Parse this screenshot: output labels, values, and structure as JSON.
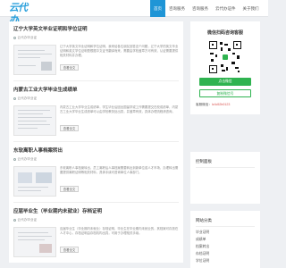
{
  "header": {
    "logo_text": "云代办",
    "nav": [
      {
        "label": "首页",
        "active": true
      },
      {
        "label": "咨询服务",
        "active": false
      },
      {
        "label": "咨询服务",
        "active": false
      },
      {
        "label": "云代办证件",
        "active": false
      },
      {
        "label": "关于我们",
        "active": false
      }
    ]
  },
  "posts": [
    {
      "title": "辽宁大学英文毕业证明和学位证明",
      "author": "云代办毕业证",
      "date": "2023",
      "excerpt": "辽宁大学英文毕业证明和学位证明，我来给各位朋友回答这个问题，辽宁大学的英文毕业证明和英文学位证明是根据中文证书翻译而来，需要由学校盖章方可有效，认证需要提供相关材料并办理。",
      "more": "查看全文"
    },
    {
      "title": "内蒙古工业大学毕业生成绩单",
      "author": "云代办毕业证",
      "date": "2023",
      "excerpt": "内蒙古工业大学毕业生成绩单，学生毕业后因出国留学或工作需要提交在校成绩单，内蒙古工业大学毕业生成绩单可以由学校教务处出具，并盖章有效，具体办理流程请咨询。",
      "more": "查看全文"
    },
    {
      "title": "东软离职人事档案转出",
      "author": "云代办毕业证",
      "date": "2023",
      "excerpt": "东软离职人事档案转出，员工离职后人事档案需要转出到新单位或人才市场，办理转出需要提供离职证明等相关材料，具体手续可咨询单位人事部门。",
      "more": "查看全文"
    },
    {
      "title": "应届毕业生（毕业期内未就业）存档证明",
      "author": "云代办毕业证",
      "date": "2023",
      "excerpt": "应届毕业生（毕业期内未就业）存档证明，毕业生在毕业期内未就业的，其档案可存放在人才中心，存档证明由存档机构出具，可用于办理相关手续。",
      "more": "查看全文"
    }
  ],
  "sidebar": {
    "qr_title": "微信扫码咨询客服",
    "wechat_btn": "点击微信",
    "copy_btn": "复制微信号",
    "wechat_label": "客服微信：",
    "wechat_id": "lz4c52b0123",
    "widget1_title": "控制面板",
    "widget2_title": "网站分类",
    "categories": [
      "毕业证明",
      "成绩单",
      "档案转出",
      "存档证明",
      "学位证明"
    ]
  },
  "colors": {
    "accent": "#1f95d6",
    "wechat_green": "#2fb350",
    "logo_blue": "#2aa0dc"
  }
}
